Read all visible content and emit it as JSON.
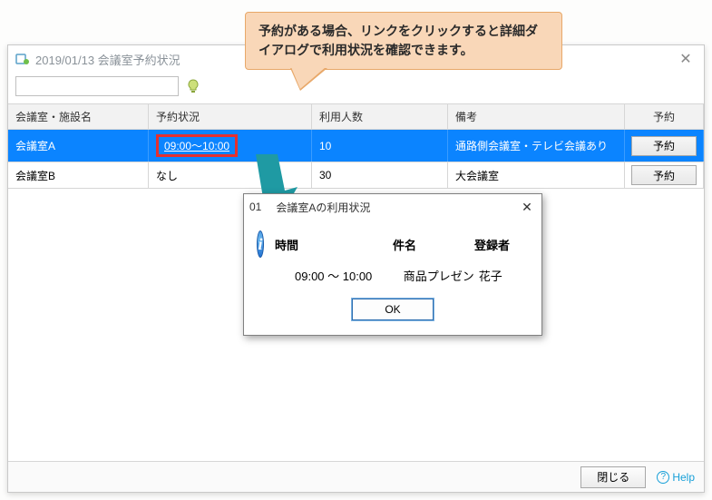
{
  "window": {
    "title": "2019/01/13 会議室予約状況"
  },
  "toolbar": {
    "search_value": ""
  },
  "columns": {
    "room": "会議室・施設名",
    "status": "予約状況",
    "capacity": "利用人数",
    "note": "備考",
    "action": "予約"
  },
  "rows": [
    {
      "room": "会議室A",
      "status": "09:00～10:00",
      "status_is_link": true,
      "capacity": "10",
      "note": "通路側会議室・テレビ会議あり",
      "action": "予約",
      "selected": true
    },
    {
      "room": "会議室B",
      "status": "なし",
      "status_is_link": false,
      "capacity": "30",
      "note": "大会議室",
      "action": "予約",
      "selected": false
    }
  ],
  "footer": {
    "close_label": "閉じる",
    "help_label": "Help"
  },
  "callout": {
    "text": "予約がある場合、リンクをクリックすると詳細ダイアログで利用状況を確認できます。"
  },
  "dialog": {
    "title_prefix": "01",
    "title": "会議室Aの利用状況",
    "col_time": "時間",
    "col_subject": "件名",
    "col_registrant": "登録者",
    "rows": [
      {
        "time": "09:00 ～ 10:00",
        "subject": "商品プレゼン",
        "registrant": "花子"
      }
    ],
    "ok_label": "OK"
  }
}
